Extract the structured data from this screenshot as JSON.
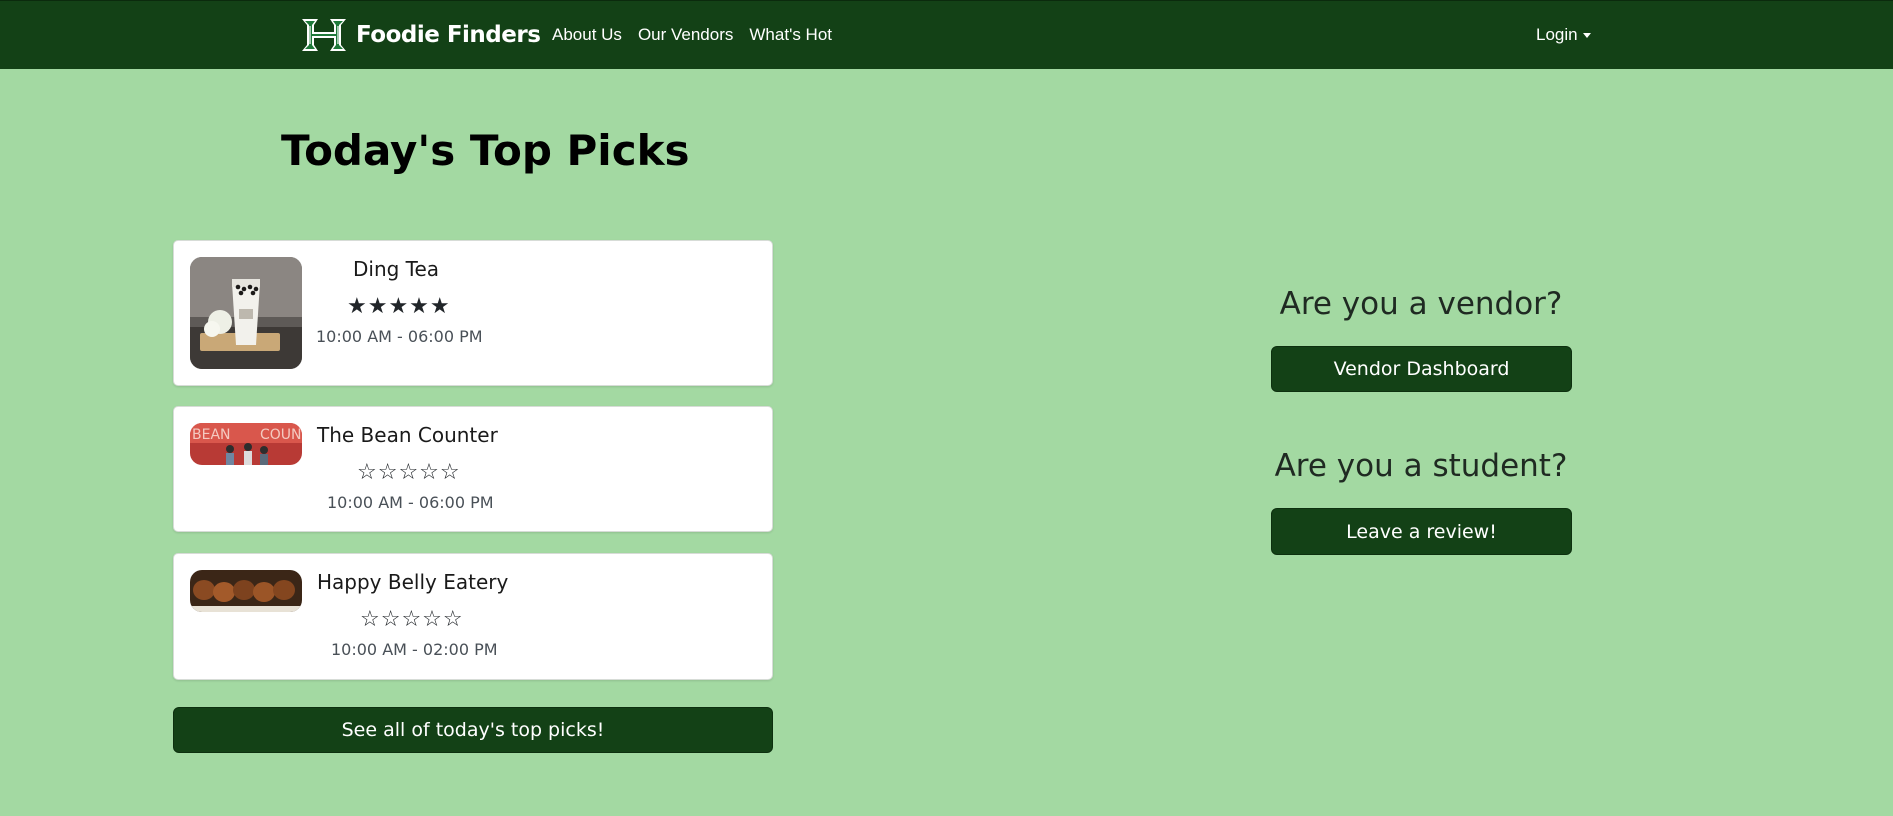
{
  "navbar": {
    "brand": "Foodie Finders",
    "links": [
      "About Us",
      "Our Vendors",
      "What's Hot"
    ],
    "login": "Login"
  },
  "main": {
    "title": "Today's Top Picks",
    "vendors": [
      {
        "name": "Ding Tea",
        "stars": "★★★★★",
        "rating": 5,
        "hours": "10:00 AM - 06:00 PM"
      },
      {
        "name": "The Bean Counter",
        "stars": "☆☆☆☆☆",
        "rating": 0,
        "hours": "10:00 AM - 06:00 PM"
      },
      {
        "name": "Happy Belly Eatery",
        "stars": "☆☆☆☆☆",
        "rating": 0,
        "hours": "10:00 AM - 02:00 PM"
      }
    ],
    "see_all": "See all of today's top picks!"
  },
  "side": {
    "vendor_heading": "Are you a vendor?",
    "vendor_button": "Vendor Dashboard",
    "student_heading": "Are you a student?",
    "student_button": "Leave a review!"
  },
  "colors": {
    "background": "#a3d9a2",
    "nav": "#134116",
    "button": "#134116"
  }
}
